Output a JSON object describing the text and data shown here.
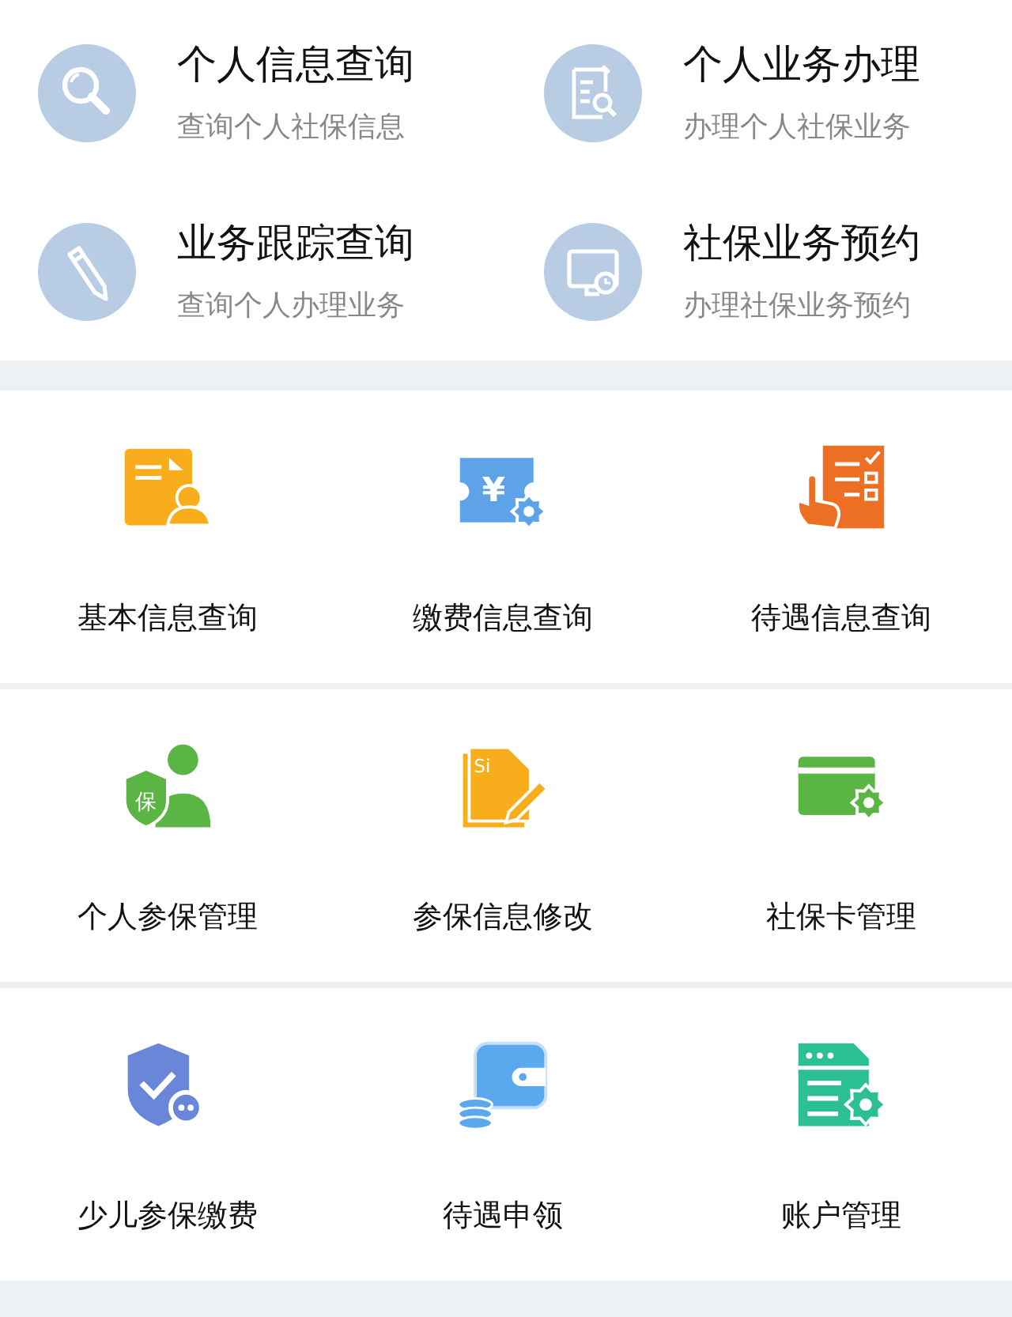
{
  "quick_links": [
    {
      "kind": "search",
      "title": "个人信息查询",
      "subtitle": "查询个人社保信息"
    },
    {
      "kind": "doc-search",
      "title": "个人业务办理",
      "subtitle": "办理个人社保业务"
    },
    {
      "kind": "pencil",
      "title": "业务跟踪查询",
      "subtitle": "查询个人办理业务"
    },
    {
      "kind": "monitor",
      "title": "社保业务预约",
      "subtitle": "办理社保业务预约"
    }
  ],
  "services": [
    [
      {
        "kind": "doc-person",
        "label": "基本信息查询"
      },
      {
        "kind": "ticket",
        "label": "缴费信息查询",
        "glyph": "¥"
      },
      {
        "kind": "checklist",
        "label": "待遇信息查询"
      }
    ],
    [
      {
        "kind": "shield-person",
        "label": "个人参保管理",
        "glyph": "保"
      },
      {
        "kind": "doc-pencil",
        "label": "参保信息修改",
        "glyph": "Si"
      },
      {
        "kind": "card",
        "label": "社保卡管理"
      }
    ],
    [
      {
        "kind": "shield-check",
        "label": "少儿参保缴费"
      },
      {
        "kind": "wallet",
        "label": "待遇申领"
      },
      {
        "kind": "server",
        "label": "账户管理"
      }
    ]
  ]
}
